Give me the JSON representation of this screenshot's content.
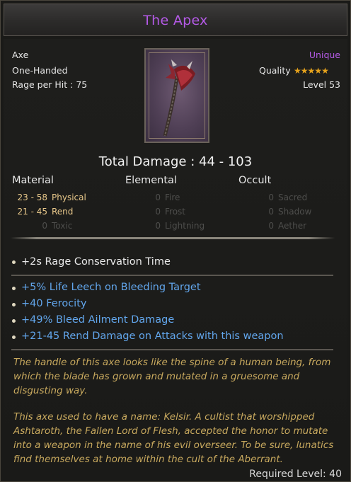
{
  "item": {
    "name": "The Apex",
    "type": "Axe",
    "handedness": "One-Handed",
    "rage_per_hit": "Rage per Hit : 75",
    "rarity": "Unique",
    "quality_label": "Quality",
    "quality_stars": 5,
    "level": "Level 53",
    "icon": "axe-icon"
  },
  "total_damage": "Total Damage : 44 - 103",
  "categories": {
    "material": "Material",
    "elemental": "Elemental",
    "occult": "Occult"
  },
  "damage": {
    "material": [
      {
        "value": "23 - 58",
        "type": "Physical",
        "active": true
      },
      {
        "value": "21 - 45",
        "type": "Rend",
        "active": true
      },
      {
        "value": "0",
        "type": "Toxic",
        "active": false
      }
    ],
    "elemental": [
      {
        "value": "0",
        "type": "Fire",
        "active": false
      },
      {
        "value": "0",
        "type": "Frost",
        "active": false
      },
      {
        "value": "0",
        "type": "Lightning",
        "active": false
      }
    ],
    "occult": [
      {
        "value": "0",
        "type": "Sacred",
        "active": false
      },
      {
        "value": "0",
        "type": "Shadow",
        "active": false
      },
      {
        "value": "0",
        "type": "Aether",
        "active": false
      }
    ]
  },
  "implicit": [
    "+2s Rage Conservation Time"
  ],
  "affixes": [
    "+5% Life Leech on Bleeding Target",
    "+40 Ferocity",
    "+49% Bleed Ailment Damage",
    "+21-45 Rend Damage on Attacks with this weapon"
  ],
  "lore": [
    "The handle of this axe looks like the spine of a human being, from which the blade has grown and mutated in a gruesome and disgusting way.",
    "This axe used to have a name: Kelsir. A cultist that worshipped Ashtaroth, the Fallen Lord of Flesh, accepted the honor to mutate into a weapon in the name of his evil overseer. To be sure, lunatics find themselves at home within the cult of the Aberrant."
  ],
  "required_level": "Required Level: 40",
  "colors": {
    "unique": "#b45ae6",
    "affix": "#62a6ec",
    "lore": "#c8a95e",
    "star": "#e5a21c",
    "active_damage": "#e8c88a",
    "inactive_damage": "#4e4e4c"
  }
}
